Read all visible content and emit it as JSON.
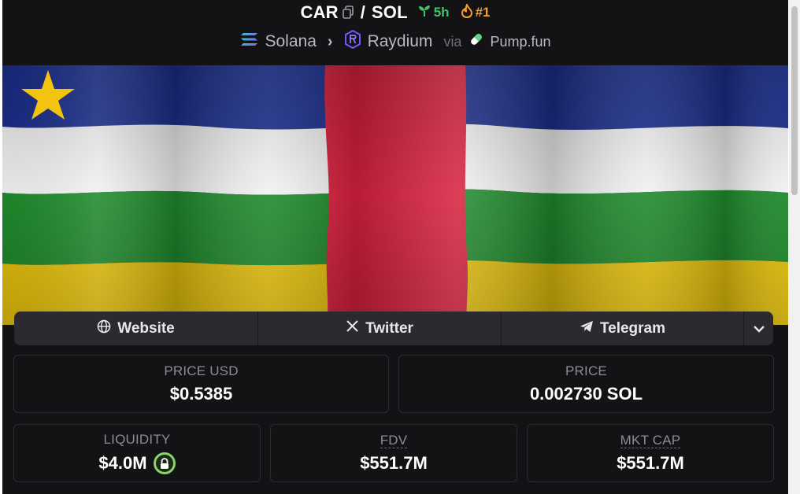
{
  "header": {
    "base_symbol": "CAR",
    "separator": "/",
    "quote_symbol": "SOL",
    "age": "5h",
    "rank": "#1",
    "chain": "Solana",
    "dex": "Raydium",
    "via_label": "via",
    "launchpad": "Pump.fun"
  },
  "socials": {
    "website_label": "Website",
    "twitter_label": "Twitter",
    "telegram_label": "Telegram"
  },
  "stats": {
    "price_usd": {
      "label": "PRICE USD",
      "value": "$0.5385"
    },
    "price": {
      "label": "PRICE",
      "value": "0.002730 SOL"
    },
    "liquidity": {
      "label": "LIQUIDITY",
      "value": "$4.0M"
    },
    "fdv": {
      "label": "FDV",
      "value": "$551.7M"
    },
    "mkt_cap": {
      "label": "MKT CAP",
      "value": "$551.7M"
    }
  },
  "colors": {
    "background": "#131316",
    "age_green": "#3fc46a",
    "rank_orange": "#f59e2a",
    "liquidity_lock_green": "#8bd36a",
    "flag_blue": "#1c2f8f",
    "flag_white": "#f2f2f2",
    "flag_green": "#1f8a2c",
    "flag_yellow": "#e8c30c",
    "flag_red": "#d8203e"
  },
  "icons": {
    "copy": "copy-icon",
    "age": "seedling-icon",
    "rank": "flame-icon",
    "chain": "solana-icon",
    "dex": "raydium-icon",
    "launchpad": "pill-icon",
    "website": "globe-icon",
    "twitter": "x-icon",
    "telegram": "telegram-icon",
    "more": "chevron-down-icon",
    "liquidity": "lock-icon"
  }
}
